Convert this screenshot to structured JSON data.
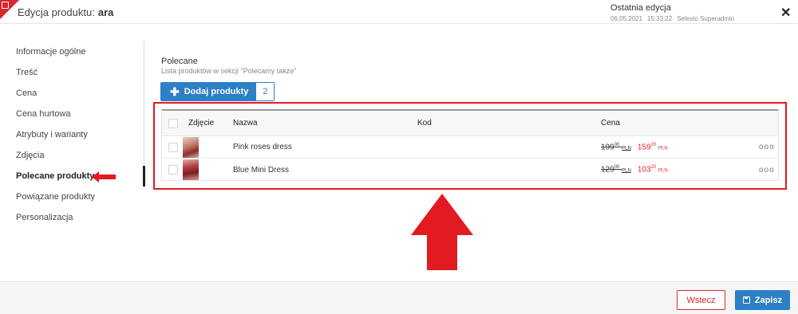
{
  "header": {
    "title_label": "Edycja produktu:",
    "title_value": "ara",
    "last_edit_label": "Ostatnia edycja",
    "last_edit_date": "06.05.2021",
    "last_edit_time": "15:33:22",
    "last_edit_user": "Selesto Superadmin",
    "close_icon": "close-icon",
    "brand_color": "#d9262e"
  },
  "sidebar": {
    "items": [
      {
        "label": "Informacje ogólne",
        "active": false
      },
      {
        "label": "Treść",
        "active": false
      },
      {
        "label": "Cena",
        "active": false
      },
      {
        "label": "Cena hurtowa",
        "active": false
      },
      {
        "label": "Atrybuty i warianty",
        "active": false
      },
      {
        "label": "Zdjęcia",
        "active": false
      },
      {
        "label": "Polecane produkty",
        "active": true
      },
      {
        "label": "Powiązane produkty",
        "active": false
      },
      {
        "label": "Personalizacja",
        "active": false
      }
    ]
  },
  "main": {
    "section_title": "Polecane",
    "section_subtitle": "Lista produktów w sekcji \"Polecamy także\"",
    "add_button_label": "Dodaj produkty",
    "add_button_count": "2",
    "table": {
      "headers": {
        "photo": "Zdjęcie",
        "name": "Nazwa",
        "code": "Kod",
        "price": "Cena"
      },
      "rows": [
        {
          "name": "Pink roses dress",
          "code": "",
          "old_price_int": "199",
          "old_price_dec": "00",
          "old_currency": "PLN",
          "new_price_int": "159",
          "new_price_dec": "20",
          "new_currency": "PLN",
          "more": "ooo"
        },
        {
          "name": "Blue Mini Dress",
          "code": "",
          "old_price_int": "129",
          "old_price_dec": "00",
          "old_currency": "PLN",
          "new_price_int": "103",
          "new_price_dec": "20",
          "new_currency": "PLN",
          "more": "ooo"
        }
      ]
    }
  },
  "annotations": {
    "highlight_color": "#e21a22"
  },
  "footer": {
    "back_label": "Wstecz",
    "save_label": "Zapisz",
    "accent_color": "#2d7fc6"
  }
}
